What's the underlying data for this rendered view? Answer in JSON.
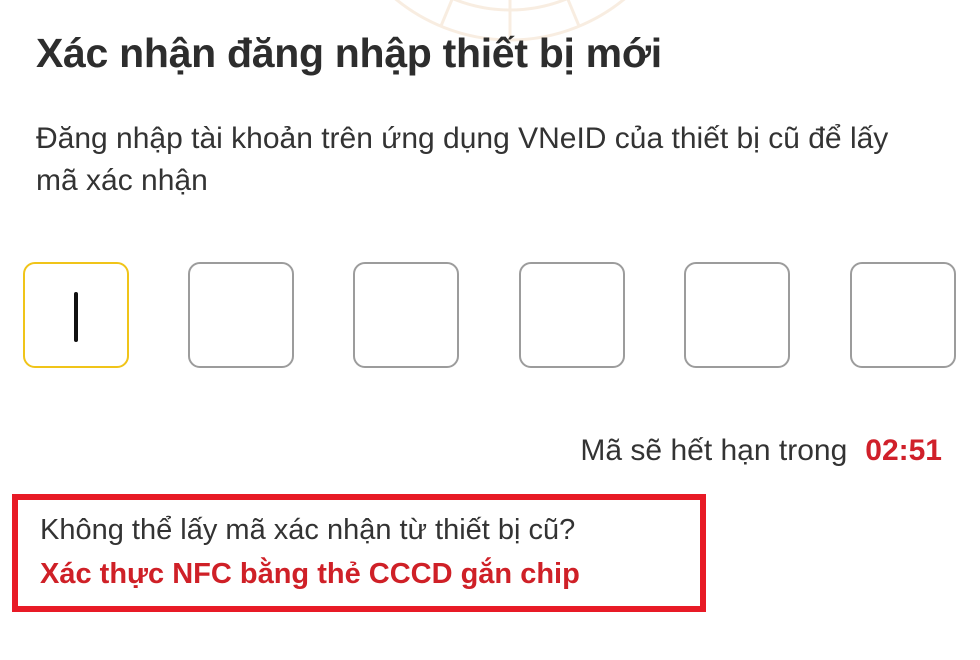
{
  "header": {
    "title": "Xác nhận đăng nhập thiết bị mới",
    "subtitle": "Đăng nhập tài khoản trên ứng dụng VNeID của thiết bị cũ để lấy mã xác nhận"
  },
  "otp": {
    "length": 6,
    "values": [
      "",
      "",
      "",
      "",
      "",
      ""
    ],
    "active_index": 0
  },
  "expiry": {
    "label": "Mã sẽ hết hạn trong",
    "timer": "02:51"
  },
  "help": {
    "question": "Không thể lấy mã xác nhận từ thiết bị cũ?",
    "link": "Xác thực NFC bằng thẻ CCCD gắn chip"
  },
  "colors": {
    "accent_red": "#cf2027",
    "highlight_border": "#e81a26",
    "active_box": "#f0c419"
  }
}
